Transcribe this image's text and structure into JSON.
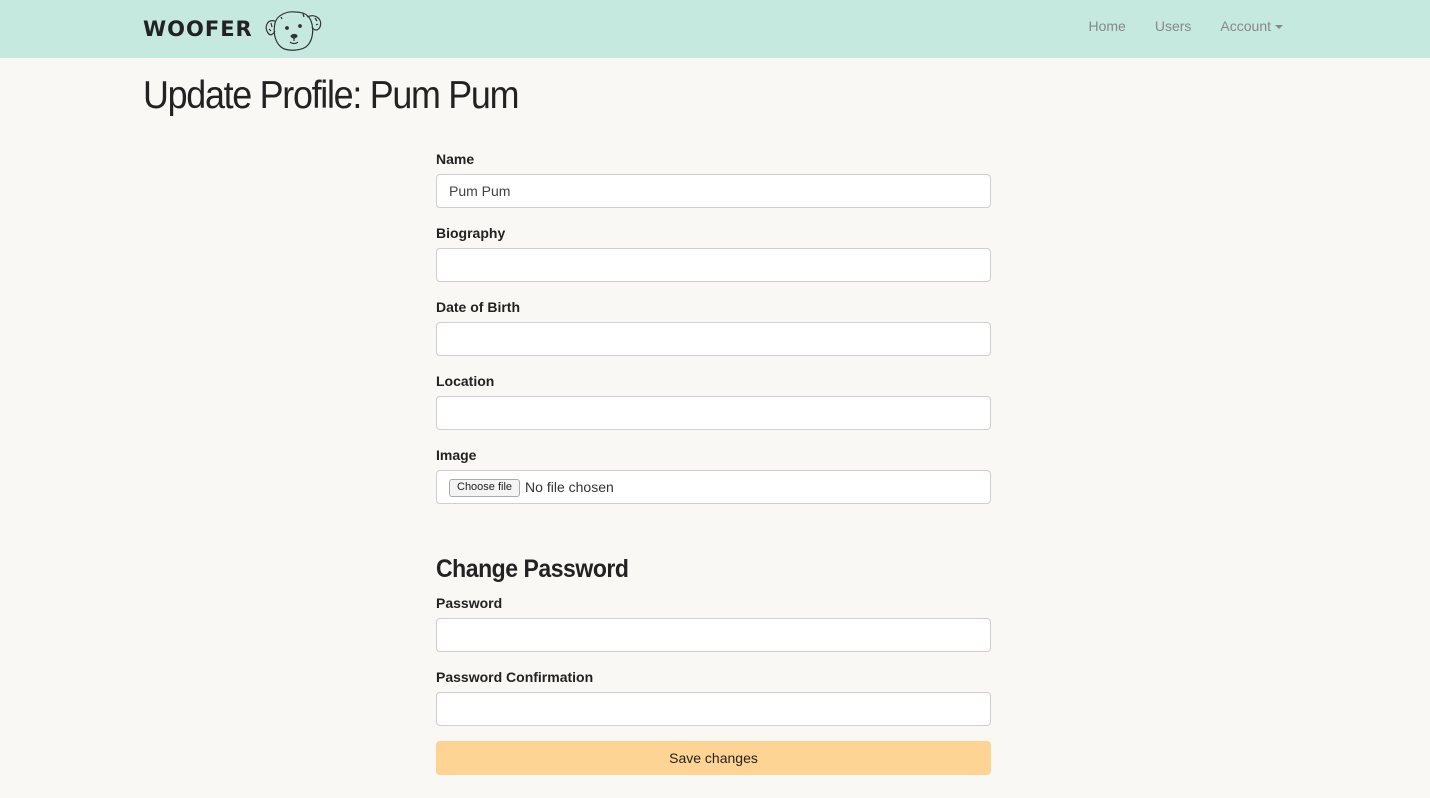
{
  "brand": {
    "name": "WOOFER",
    "logo_icon": "dog-face-icon"
  },
  "nav": {
    "home": "Home",
    "users": "Users",
    "account": "Account"
  },
  "page_title": "Update Profile: Pum Pum",
  "form": {
    "name": {
      "label": "Name",
      "value": "Pum Pum"
    },
    "biography": {
      "label": "Biography",
      "value": ""
    },
    "dob": {
      "label": "Date of Birth",
      "value": ""
    },
    "location": {
      "label": "Location",
      "value": ""
    },
    "image": {
      "label": "Image",
      "button": "Choose file",
      "status": "No file chosen"
    },
    "change_password_title": "Change Password",
    "password": {
      "label": "Password",
      "value": ""
    },
    "password_confirmation": {
      "label": "Password Confirmation",
      "value": ""
    },
    "save_label": "Save changes"
  },
  "colors": {
    "navbar_bg": "#c5e9df",
    "page_bg": "#f9f8f4",
    "save_button": "#fdd493"
  }
}
